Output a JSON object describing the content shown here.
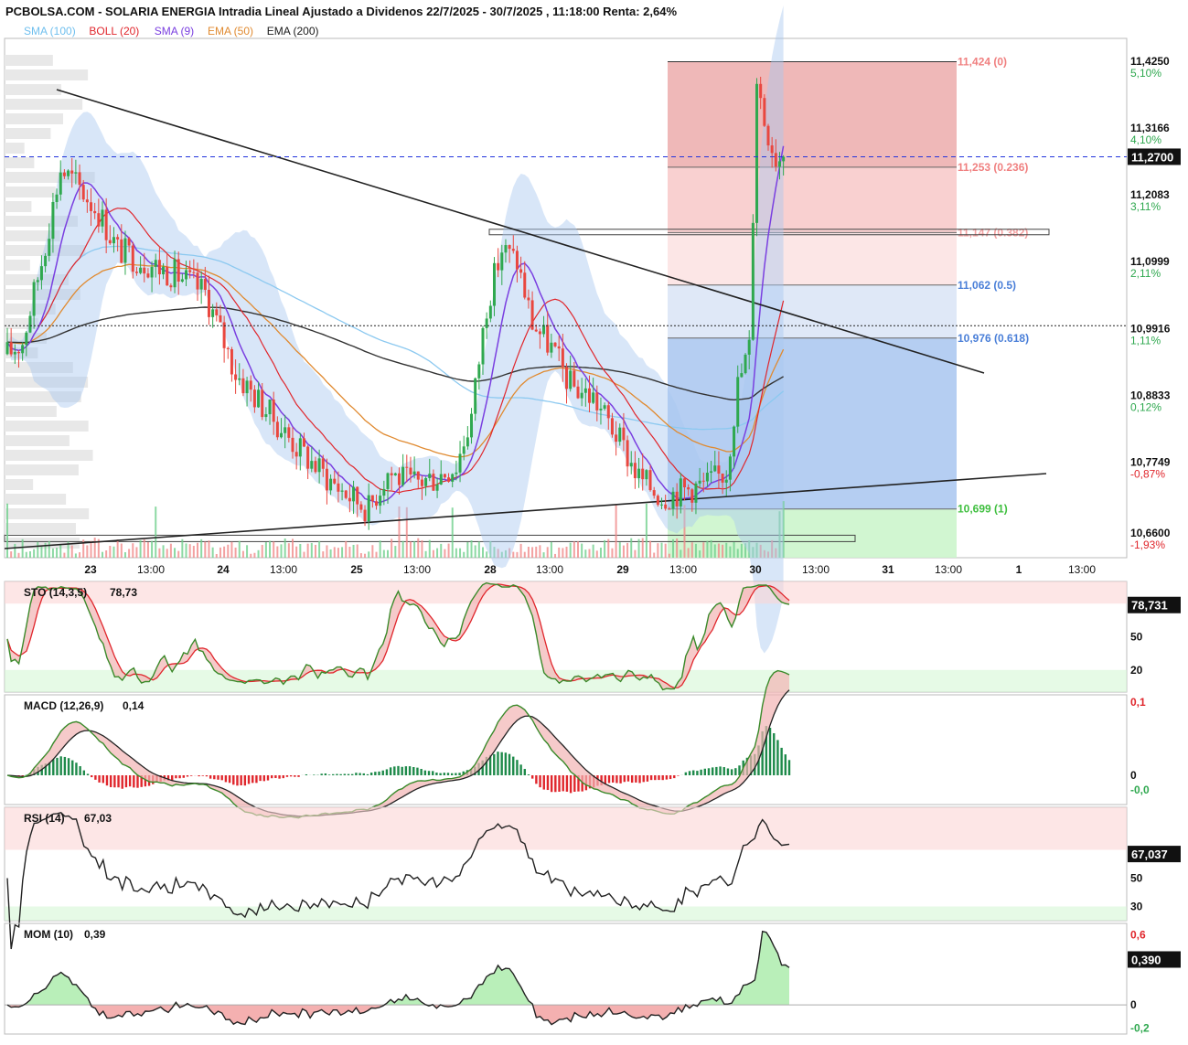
{
  "header": {
    "title": "PCBOLSA.COM - SOLARIA ENERGIA Intradia Lineal Ajustado a Dividenos 22/7/2025 - 30/7/2025 , 11:18:00 Renta: 2,64%"
  },
  "legend": [
    {
      "label": "SMA (100)",
      "color": "#6fbfee"
    },
    {
      "label": "BOLL (20)",
      "color": "#e0262c"
    },
    {
      "label": "SMA (9)",
      "color": "#7a3fe0"
    },
    {
      "label": "EMA (50)",
      "color": "#e08a30"
    },
    {
      "label": "EMA (200)",
      "color": "#1a1a1a"
    }
  ],
  "colors": {
    "up": "#2fa84f",
    "down": "#e9473f",
    "boll_band": "#a9c8ef",
    "ref_line": "#2233dd"
  },
  "price_axis": {
    "ticks": [
      {
        "price": "11,4250",
        "pct": "5,10%",
        "v": 11.425
      },
      {
        "price": "11,3166",
        "pct": "4,10%",
        "v": 11.3166
      },
      {
        "price": "11,2083",
        "pct": "3,11%",
        "v": 11.2083
      },
      {
        "price": "11,0999",
        "pct": "2,11%",
        "v": 11.0999
      },
      {
        "price": "10,9916",
        "pct": "1,11%",
        "v": 10.9916
      },
      {
        "price": "10,8833",
        "pct": "0,12%",
        "v": 10.8833
      },
      {
        "price": "10,7749",
        "pct": "-0,87%",
        "v": 10.7749
      },
      {
        "price": "10,6600",
        "pct": "-1,93%",
        "v": 10.66
      }
    ],
    "current": "11,2700",
    "current_value": 11.27
  },
  "fib_levels": [
    {
      "label": "11,424 (0)",
      "v": 11.424,
      "color": "#f08080"
    },
    {
      "label": "11,253 (0.236)",
      "v": 11.253,
      "color": "#f08080"
    },
    {
      "label": "11,147 (0.382)",
      "v": 11.147,
      "color": "#f4a0a0"
    },
    {
      "label": "11,062 (0.5)",
      "v": 11.062,
      "color": "#4a7fd8"
    },
    {
      "label": "10,976 (0.618)",
      "v": 10.976,
      "color": "#4a7fd8"
    },
    {
      "label": "10,699 (1)",
      "v": 10.699,
      "color": "#3fbf3f"
    }
  ],
  "time_axis": [
    "23",
    "13:00",
    "24",
    "13:00",
    "25",
    "13:00",
    "28",
    "13:00",
    "29",
    "13:00",
    "30",
    "13:00",
    "31",
    "13:00",
    "1",
    "13:00"
  ],
  "sto": {
    "label": "STO (14,3,5)",
    "value": "78,73",
    "badge": "78,731",
    "ticks": [
      "50",
      "20"
    ]
  },
  "macd": {
    "label": "MACD (12,26,9)",
    "value": "0,14",
    "ticks": [
      "0,1",
      "0",
      "-0,0"
    ]
  },
  "rsi": {
    "label": "RSI (14)",
    "value": "67,03",
    "badge": "67,037",
    "ticks": [
      "50",
      "30"
    ]
  },
  "mom": {
    "label": "MOM (10)",
    "value": "0,39",
    "badge": "0,390",
    "ticks": [
      "0,6",
      "0",
      "-0,2"
    ]
  },
  "chart_data": {
    "type": "candlestick",
    "title": "PCBOLSA.COM - SOLARIA ENERGIA Intradia Lineal Ajustado a Dividenos 22/7/2025 - 30/7/2025 , 11:18:00 Renta: 2,64%",
    "y_range": [
      10.62,
      11.45
    ],
    "approx_close_path": [
      [
        0,
        10.95
      ],
      [
        4,
        10.97
      ],
      [
        9,
        11.1
      ],
      [
        14,
        11.25
      ],
      [
        19,
        11.22
      ],
      [
        24,
        11.18
      ],
      [
        29,
        11.12
      ],
      [
        36,
        11.1
      ],
      [
        44,
        11.08
      ],
      [
        52,
        11.05
      ],
      [
        60,
        10.92
      ],
      [
        68,
        10.86
      ],
      [
        76,
        10.8
      ],
      [
        84,
        10.75
      ],
      [
        90,
        10.72
      ],
      [
        95,
        10.7
      ],
      [
        100,
        10.76
      ],
      [
        106,
        10.74
      ],
      [
        112,
        10.75
      ],
      [
        118,
        10.77
      ],
      [
        122,
        10.85
      ],
      [
        126,
        11.03
      ],
      [
        130,
        11.12
      ],
      [
        134,
        11.1
      ],
      [
        138,
        11.0
      ],
      [
        143,
        10.96
      ],
      [
        148,
        10.9
      ],
      [
        154,
        10.88
      ],
      [
        160,
        10.82
      ],
      [
        166,
        10.75
      ],
      [
        172,
        10.72
      ],
      [
        178,
        10.73
      ],
      [
        184,
        10.74
      ],
      [
        189,
        10.76
      ],
      [
        192,
        10.9
      ],
      [
        195,
        10.96
      ],
      [
        197,
        11.4
      ],
      [
        199,
        11.33
      ],
      [
        202,
        11.27
      ]
    ],
    "current_close": 11.27,
    "renta_pct": 2.64,
    "indicators": {
      "sto_k": 78.73,
      "macd": 0.14,
      "rsi": 67.03,
      "mom": 0.39
    }
  }
}
